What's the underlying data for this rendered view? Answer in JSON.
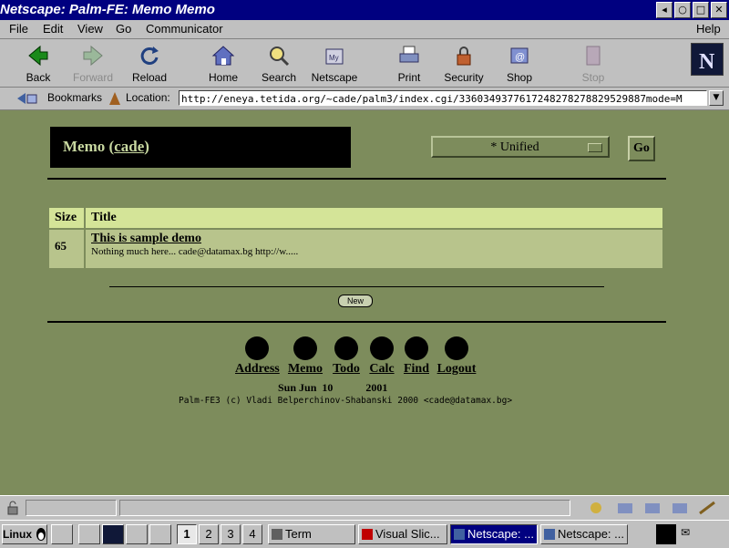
{
  "window": {
    "title": "Netscape: Palm-FE: Memo Memo",
    "controls": [
      "minimize",
      "maximize",
      "close"
    ]
  },
  "menubar": [
    "File",
    "Edit",
    "View",
    "Go",
    "Communicator",
    "Help"
  ],
  "toolbar": [
    {
      "label": "Back",
      "icon": "back-arrow-icon"
    },
    {
      "label": "Forward",
      "icon": "forward-arrow-icon",
      "disabled": true
    },
    {
      "label": "Reload",
      "icon": "reload-icon"
    },
    {
      "label": "Home",
      "icon": "home-icon"
    },
    {
      "label": "Search",
      "icon": "search-icon"
    },
    {
      "label": "Netscape",
      "icon": "netscape-icon"
    },
    {
      "label": "Print",
      "icon": "print-icon"
    },
    {
      "label": "Security",
      "icon": "lock-icon"
    },
    {
      "label": "Shop",
      "icon": "shop-icon"
    },
    {
      "label": "Stop",
      "icon": "stop-icon",
      "disabled": true
    }
  ],
  "location": {
    "bookmarks_label": "Bookmarks",
    "location_label": "Location:",
    "url": "http://eneya.tetida.org/~cade/palm3/index.cgi/3360349377617248278278829529887mode=M"
  },
  "page": {
    "app_name": "Memo",
    "user_paren_open": "(",
    "user": "cade",
    "user_paren_close": ")",
    "category_value": "* Unified",
    "go_label": "Go",
    "table": {
      "headers": [
        "Size",
        "Title"
      ],
      "rows": [
        {
          "size": "65",
          "title": "This is sample demo",
          "snippet": "Nothing much here... cade@datamax.bg http://w....."
        }
      ]
    },
    "new_label": "New",
    "apps": [
      "Address",
      "Memo",
      "Todo",
      "Calc",
      "Find",
      "Logout"
    ],
    "date": {
      "weekday": "Sun",
      "month": "Jun",
      "day": "10",
      "year": "2001"
    },
    "copyright": "Palm-FE3 (c) Vladi Belperchinov-Shabanski 2000 <cade@datamax.bg>"
  },
  "taskbar": {
    "start_label": "Linux",
    "desktops": [
      "1",
      "2",
      "3",
      "4"
    ],
    "active_desktop": "1",
    "tasks": [
      {
        "label": "Term"
      },
      {
        "label": "Visual Slic..."
      },
      {
        "label": "Netscape: ..."
      },
      {
        "label": "Netscape: ..."
      }
    ]
  },
  "colors": {
    "page_bg": "#7d8c5c",
    "header_cell": "#d4e498",
    "row_cell": "#b8c48c",
    "titlebar": "#000080"
  }
}
